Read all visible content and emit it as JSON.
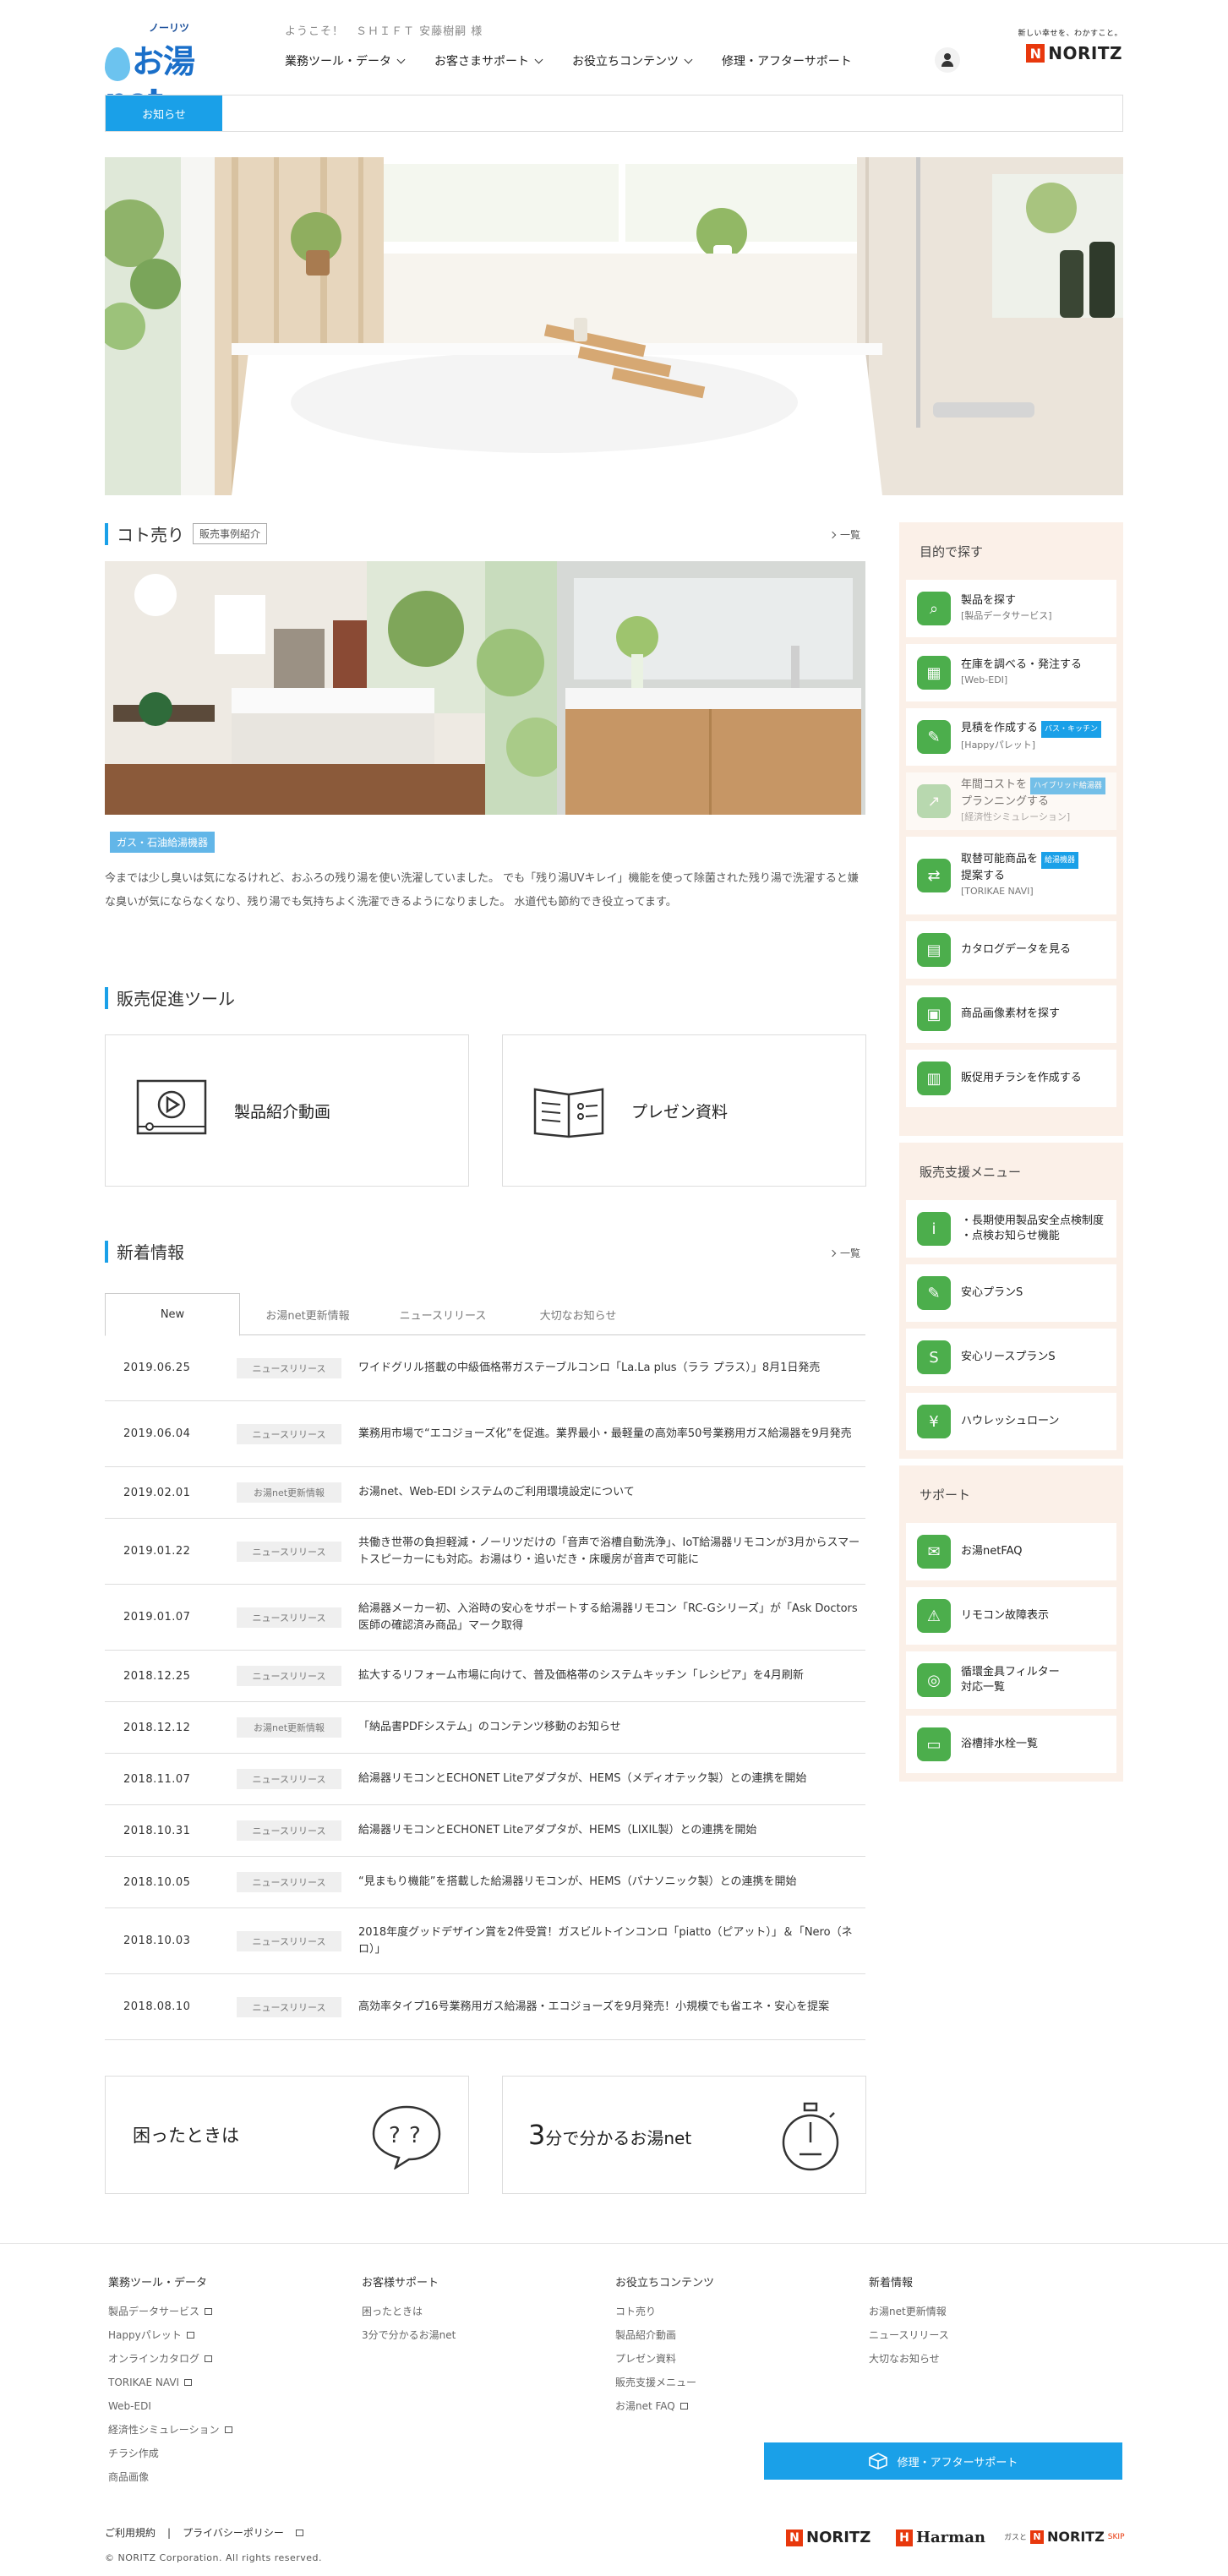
{
  "header": {
    "logo_kana": "ノーリツ",
    "logo_text": "お湯net",
    "welcome": "ようこそ！　ＳＨＩＦＴ 安藤樹嗣 様",
    "nav": [
      {
        "label": "業務ツール・データ"
      },
      {
        "label": "お客さまサポート"
      },
      {
        "label": "お役立ちコンテンツ"
      },
      {
        "label": "修理・アフターサポート"
      }
    ],
    "brand_tagline": "新しい幸せを、わかすこと。",
    "brand_name": "NORITZ"
  },
  "news_bar": {
    "label": "お知らせ"
  },
  "koto": {
    "title": "コト売り",
    "tag": "販売事例紹介",
    "more": "一覧",
    "badge": "ガス・石油給湯機器",
    "text": "今までは少し臭いは気になるけれど、おふろの残り湯を使い洗濯していました。 でも「残り湯UVキレイ」機能を使って除菌された残り湯で洗濯すると嫌な臭いが気にならなくなり、残り湯でも気持ちよく洗濯できるようになりました。 水道代も節約でき役立ってます。"
  },
  "promo": {
    "title": "販売促進ツール",
    "cards": [
      {
        "label": "製品紹介動画",
        "icon": "video-icon"
      },
      {
        "label": "プレゼン資料",
        "icon": "document-icon"
      }
    ]
  },
  "news": {
    "title": "新着情報",
    "more": "一覧",
    "tabs": [
      "New",
      "お湯net更新情報",
      "ニュースリリース",
      "大切なお知らせ"
    ],
    "items": [
      {
        "date": "2019.06.25",
        "cat": "ニュースリリース",
        "title": "ワイドグリル搭載の中級価格帯ガステーブルコンロ「La.La plus（ララ プラス）」8月1日発売"
      },
      {
        "date": "2019.06.04",
        "cat": "ニュースリリース",
        "title": "業務用市場で“エコジョーズ化”を促進。業界最小・最軽量の高効率50号業務用ガス給湯器を9月発売"
      },
      {
        "date": "2019.02.01",
        "cat": "お湯net更新情報",
        "title": "お湯net、Web-EDI システムのご利用環境設定について"
      },
      {
        "date": "2019.01.22",
        "cat": "ニュースリリース",
        "title": "共働き世帯の負担軽減・ノーリツだけの「音声で浴槽自動洗浄」、IoT給湯器リモコンが3月からスマートスピーカーにも対応。お湯はり・追いだき・床暖房が音声で可能に"
      },
      {
        "date": "2019.01.07",
        "cat": "ニュースリリース",
        "title": "給湯器メーカー初、入浴時の安心をサポートする給湯器リモコン「RC-Gシリーズ」が「Ask Doctors 医師の確認済み商品」マーク取得"
      },
      {
        "date": "2018.12.25",
        "cat": "ニュースリリース",
        "title": "拡大するリフォーム市場に向けて、普及価格帯のシステムキッチン「レシピア」を4月刷新"
      },
      {
        "date": "2018.12.12",
        "cat": "お湯net更新情報",
        "title": "「納品書PDFシステム」のコンテンツ移動のお知らせ"
      },
      {
        "date": "2018.11.07",
        "cat": "ニュースリリース",
        "title": "給湯器リモコンとECHONET Liteアダプタが、HEMS（メディオテック製）との連携を開始"
      },
      {
        "date": "2018.10.31",
        "cat": "ニュースリリース",
        "title": "給湯器リモコンとECHONET Liteアダプタが、HEMS（LIXIL製）との連携を開始"
      },
      {
        "date": "2018.10.05",
        "cat": "ニュースリリース",
        "title": "“見まもり機能”を搭載した給湯器リモコンが、HEMS（パナソニック製）との連携を開始"
      },
      {
        "date": "2018.10.03",
        "cat": "ニュースリリース",
        "title": "2018年度グッドデザイン賞を2件受賞！ガスビルトインコンロ「piatto（ピアット）」＆「Nero（ネロ）」"
      },
      {
        "date": "2018.08.10",
        "cat": "ニュースリリース",
        "title": "高効率タイプ16号業務用ガス給湯器・エコジョーズを9月発売！小規模でも省エネ・安心を提案"
      }
    ]
  },
  "bottom_cards": [
    {
      "label": "困ったときは"
    },
    {
      "label_big": "3",
      "label_rest": "分で分かるお湯net"
    }
  ],
  "sidebar": {
    "purpose": {
      "title": "目的で探す",
      "items": [
        {
          "label": "製品を探す",
          "sub": "[製品データサービス]",
          "chip": ""
        },
        {
          "label": "在庫を調べる・発注する",
          "sub": "[Web-EDI]",
          "chip": ""
        },
        {
          "label": "見積を作成する",
          "sub": "[Happyパレット]",
          "chip": "バス・キッチン"
        },
        {
          "label": "年間コストを",
          "label2": "プランニングする",
          "sub": "[経済性シミュレーション]",
          "chip": "ハイブリッド給湯器"
        },
        {
          "label": "取替可能商品を",
          "label2": "提案する",
          "sub": "[TORIKAE NAVI]",
          "chip": "給湯機器"
        },
        {
          "label": "カタログデータを見る",
          "sub": "",
          "chip": ""
        },
        {
          "label": "商品画像素材を探す",
          "sub": "",
          "chip": ""
        },
        {
          "label": "販促用チラシを作成する",
          "sub": "",
          "chip": ""
        }
      ]
    },
    "support_menu": {
      "title": "販売支援メニュー",
      "items": [
        {
          "label": "・長期使用製品安全点検制度",
          "label2": "・点検お知らせ機能"
        },
        {
          "label": "安心プランS"
        },
        {
          "label": "安心リースプランS"
        },
        {
          "label": "ハウレッシュローン"
        }
      ]
    },
    "support": {
      "title": "サポート",
      "items": [
        {
          "label": "お湯netFAQ"
        },
        {
          "label": "リモコン故障表示"
        },
        {
          "label": "循環金具フィルター",
          "label2": "対応一覧"
        },
        {
          "label": "浴槽排水栓一覧"
        }
      ]
    }
  },
  "footer": {
    "cols": [
      {
        "title": "業務ツール・データ",
        "links": [
          "製品データサービス",
          "Happyパレット",
          "オンラインカタログ",
          "TORIKAE NAVI",
          "Web-EDI",
          "経済性シミュレーション",
          "チラシ作成",
          "商品画像"
        ]
      },
      {
        "title": "お客様サポート",
        "links": [
          "困ったときは",
          "3分で分かるお湯net"
        ]
      },
      {
        "title": "お役立ちコンテンツ",
        "links": [
          "コト売り",
          "製品紹介動画",
          "プレゼン資料",
          "販売支援メニュー",
          "お湯net FAQ"
        ]
      },
      {
        "title": "新着情報",
        "links": [
          "お湯net更新情報",
          "ニュースリリース",
          "大切なお知らせ"
        ]
      }
    ],
    "repair_btn": "修理・アフターサポート",
    "terms": "ご利用規約",
    "sep": "|",
    "privacy": "プライバシーポリシー",
    "copyright": "© NORITZ Corporation. All rights reserved.",
    "brands": [
      "NORITZ",
      "Harman",
      "NORITZ"
    ],
    "brand3_prefix": "ガスと",
    "brand3_suffix": "SKIP"
  },
  "colors": {
    "accent": "#1aa0e8",
    "green": "#4cae4c",
    "side_bg": "#fbf0e8",
    "brand_red": "#e8380d"
  }
}
